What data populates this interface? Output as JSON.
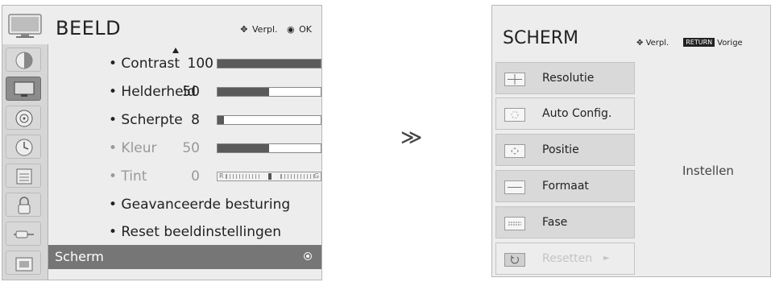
{
  "left_menu": {
    "title": "BEELD",
    "nav_hint": {
      "move": "Verpl.",
      "ok": "OK"
    },
    "sidebar_icons": [
      "picture-icon",
      "screen-icon",
      "audio-icon",
      "clock-icon",
      "options-icon",
      "lock-icon",
      "input-icon",
      "usb-icon"
    ],
    "selected_sidebar": 1,
    "rows": [
      {
        "label": "• Contrast",
        "value": "100",
        "level": 1.0,
        "dim": false
      },
      {
        "label": "• Helderheid",
        "value": "50",
        "level": 0.5,
        "dim": false
      },
      {
        "label": "• Scherpte",
        "value": "8",
        "level": 0.06,
        "dim": false
      },
      {
        "label": "• Kleur",
        "value": "50",
        "level": 0.5,
        "dim": true
      },
      {
        "label": "• Tint",
        "value": "0",
        "tint_left": "R",
        "tint_right": "G",
        "dim": true
      }
    ],
    "advanced": "• Geavanceerde besturing",
    "reset": "• Reset beeldinstellingen",
    "selected_item": "Scherm"
  },
  "arrow": "≫",
  "right_menu": {
    "title": "SCHERM",
    "nav_move": "Verpl.",
    "return_label": "RETURN",
    "return_text": "Vorige",
    "items": [
      {
        "label": "Resolutie",
        "icon": "resolution-icon"
      },
      {
        "label": "Auto Config.",
        "icon": "auto-config-icon"
      },
      {
        "label": "Positie",
        "icon": "position-icon"
      },
      {
        "label": "Formaat",
        "icon": "size-icon"
      },
      {
        "label": "Fase",
        "icon": "phase-icon"
      },
      {
        "label": "Resetten",
        "icon": "reset-icon",
        "more": "►"
      }
    ],
    "value_text": "Instellen"
  }
}
